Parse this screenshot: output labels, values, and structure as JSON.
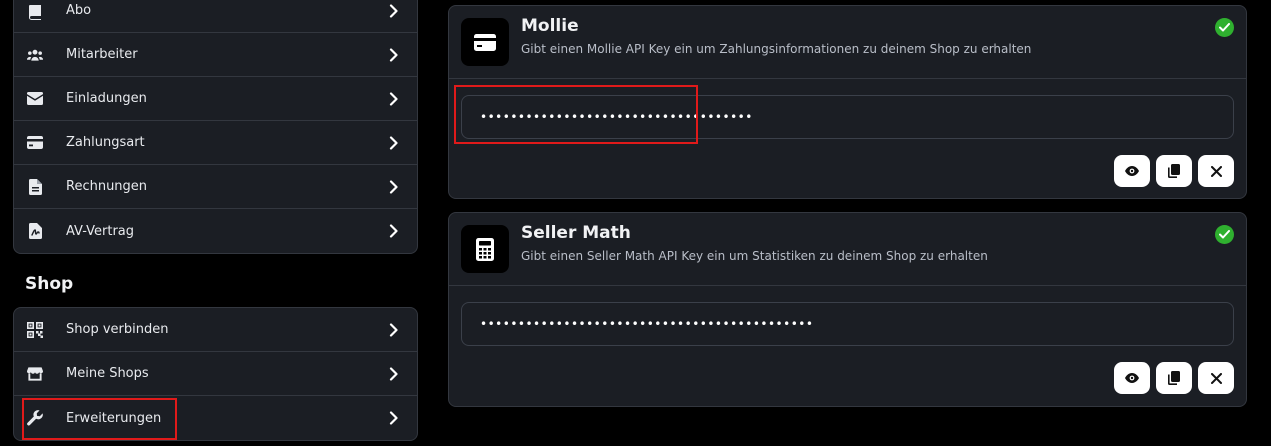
{
  "account_menu": {
    "items": [
      {
        "label": "Abo",
        "icon": "book-icon"
      },
      {
        "label": "Mitarbeiter",
        "icon": "users-icon"
      },
      {
        "label": "Einladungen",
        "icon": "envelope-icon"
      },
      {
        "label": "Zahlungsart",
        "icon": "credit-card-icon"
      },
      {
        "label": "Rechnungen",
        "icon": "invoice-icon"
      },
      {
        "label": "AV-Vertrag",
        "icon": "contract-icon"
      }
    ]
  },
  "shop_section": {
    "title": "Shop",
    "items": [
      {
        "label": "Shop verbinden",
        "icon": "qr-code-icon"
      },
      {
        "label": "Meine Shops",
        "icon": "store-icon"
      },
      {
        "label": "Erweiterungen",
        "icon": "wrench-icon"
      }
    ]
  },
  "integrations": [
    {
      "title": "Mollie",
      "description": "Gibt einen Mollie API Key ein um Zahlungsinformationen zu deinem Shop zu erhalten",
      "logo_icon": "credit-card-icon",
      "status": "connected",
      "key_value": "••••••••••••••••••••••••••••••••••••"
    },
    {
      "title": "Seller Math",
      "description": "Gibt einen Seller Math API Key ein um Statistiken zu deinem Shop zu erhalten",
      "logo_icon": "calculator-icon",
      "status": "connected",
      "key_value": "••••••••••••••••••••••••••••••••••••••••••••"
    }
  ],
  "colors": {
    "background": "#000000",
    "card": "#1b1e24",
    "border": "#33373f",
    "success": "#2fb02f",
    "highlight": "#e01a1a"
  }
}
